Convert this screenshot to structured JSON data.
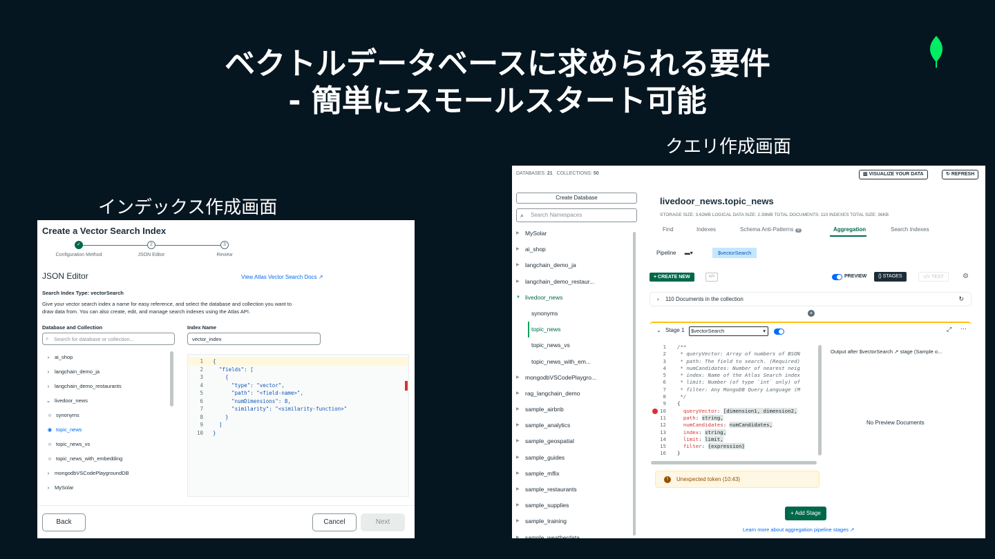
{
  "slide": {
    "title_line1": "ベクトルデータベースに求められる要件",
    "title_line2": "- 簡単にスモールスタート可能",
    "caption_left": "インデックス作成画面",
    "caption_right": "クエリ作成画面"
  },
  "index_panel": {
    "title": "Create a Vector Search Index",
    "steps": [
      "Configuration Method",
      "JSON Editor",
      "Review"
    ],
    "editor_heading": "JSON Editor",
    "docs_link": "View Atlas Vector Search Docs ↗",
    "index_type_label": "Search Index Type: vectorSearch",
    "description_line1": "Give your vector search index a name for easy reference, and select the database and collection you want to",
    "description_line2": "draw data from. You can also create, edit, and manage search indexes using the Atlas API.",
    "db_collection_label": "Database and Collection",
    "db_search_placeholder": "Search for database or collection...",
    "index_name_label": "Index Name",
    "index_name_value": "vector_index",
    "tree": [
      {
        "label": "ai_shop",
        "type": "db"
      },
      {
        "label": "langchain_demo_ja",
        "type": "db"
      },
      {
        "label": "langchain_demo_restaurants",
        "type": "db"
      },
      {
        "label": "livedoor_news",
        "type": "db-open"
      },
      {
        "label": "synonyms",
        "type": "radio"
      },
      {
        "label": "topic_news",
        "type": "radio-selected"
      },
      {
        "label": "topic_news_vs",
        "type": "radio"
      },
      {
        "label": "topic_news_with_embedding",
        "type": "radio"
      },
      {
        "label": "mongodbVSCodePlaygroundDB",
        "type": "db"
      },
      {
        "label": "MySolar",
        "type": "db"
      }
    ],
    "code": [
      "{",
      "  \"fields\": [",
      "    {",
      "      \"type\": \"vector\",",
      "      \"path\": \"<field-name>\",",
      "      \"numDimensions\": 8,",
      "      \"similarity\": \"<similarity-function>\"",
      "    }",
      "  ]",
      "}"
    ],
    "back_label": "Back",
    "cancel_label": "Cancel",
    "next_label": "Next"
  },
  "query_panel": {
    "top_info_db_label": "DATABASES:",
    "top_info_db_count": "21",
    "top_info_coll_label": "COLLECTIONS:",
    "top_info_coll_count": "50",
    "visualize_label": "VISUALIZE YOUR DATA",
    "refresh_label": "REFRESH",
    "create_db_label": "Create Database",
    "ns_search_placeholder": "Search Namespaces",
    "namespaces": [
      {
        "label": "MySolar",
        "type": "db"
      },
      {
        "label": "ai_shop",
        "type": "db"
      },
      {
        "label": "langchain_demo_ja",
        "type": "db"
      },
      {
        "label": "langchain_demo_restaur...",
        "type": "db"
      },
      {
        "label": "livedoor_news",
        "type": "db-open"
      },
      {
        "label": "synonyms",
        "type": "coll"
      },
      {
        "label": "topic_news",
        "type": "coll-active"
      },
      {
        "label": "topic_news_vs",
        "type": "coll"
      },
      {
        "label": "topic_news_with_em...",
        "type": "coll"
      },
      {
        "label": "mongodbVSCodePlaygro...",
        "type": "db"
      },
      {
        "label": "rag_langchain_demo",
        "type": "db"
      },
      {
        "label": "sample_airbnb",
        "type": "db"
      },
      {
        "label": "sample_analytics",
        "type": "db"
      },
      {
        "label": "sample_geospatial",
        "type": "db"
      },
      {
        "label": "sample_guides",
        "type": "db"
      },
      {
        "label": "sample_mflix",
        "type": "db"
      },
      {
        "label": "sample_restaurants",
        "type": "db"
      },
      {
        "label": "sample_supplies",
        "type": "db"
      },
      {
        "label": "sample_training",
        "type": "db"
      },
      {
        "label": "sample_weatherdata",
        "type": "db"
      }
    ],
    "namespace_title": "livedoor_news.topic_news",
    "stats": "STORAGE SIZE: 3.62MB     LOGICAL DATA SIZE: 2.39MB     TOTAL DOCUMENTS: 110     INDEXES TOTAL SIZE: 36KB",
    "tabs": [
      "Find",
      "Indexes",
      "Schema Anti-Patterns",
      "Aggregation",
      "Search Indexes"
    ],
    "schema_badge": "0",
    "active_tab": "Aggregation",
    "pipeline_label": "Pipeline",
    "stage_chip": "$vectorSearch",
    "create_new_label": "CREATE NEW",
    "preview_label": "PREVIEW",
    "stages_label": "{} STAGES",
    "text_label": "</> TEXT",
    "docs_in_collection": "110 Documents in the collection",
    "stage_label": "Stage 1",
    "stage_operator": "$vectorSearch",
    "code": [
      {
        "n": "1",
        "t": "/**",
        "c": "cm"
      },
      {
        "n": "2",
        "t": " * queryVector: Array of numbers of BSON",
        "c": "cm"
      },
      {
        "n": "3",
        "t": " * path: The field to search. (Required)",
        "c": "cm"
      },
      {
        "n": "4",
        "t": " * numCandidates: Number of nearest neig",
        "c": "cm"
      },
      {
        "n": "5",
        "t": " * index: Name of the Atlas Search index",
        "c": "cm"
      },
      {
        "n": "6",
        "t": " * limit: Number (of type `int` only) of",
        "c": "cm"
      },
      {
        "n": "7",
        "t": " * filter: Any MongoDB Query Language (M",
        "c": "cm"
      },
      {
        "n": "8",
        "t": " */",
        "c": "cm"
      },
      {
        "n": "9",
        "t": "{",
        "c": ""
      },
      {
        "n": "10",
        "k": "queryVector",
        "v": "[dimension1, dimension2,",
        "c": "err"
      },
      {
        "n": "11",
        "k": "path",
        "v": "string,",
        "c": ""
      },
      {
        "n": "12",
        "k": "numCandidates",
        "v": "numCandidates,",
        "c": ""
      },
      {
        "n": "13",
        "k": "index",
        "v": "string,",
        "c": ""
      },
      {
        "n": "14",
        "k": "limit",
        "v": "limit,",
        "c": ""
      },
      {
        "n": "15",
        "k": "filter",
        "v": "{expression}",
        "c": ""
      },
      {
        "n": "16",
        "t": "}",
        "c": ""
      }
    ],
    "output_label": "Output after $vectorSearch ↗ stage (Sample o...",
    "no_preview": "No Preview Documents",
    "error_text": "Unexpected token (10:43)",
    "add_stage_label": "+ Add Stage",
    "learn_link": "Learn more about aggregation pipeline stages ↗",
    "colors": {
      "brand_green": "#00684a",
      "link_blue": "#016bf8",
      "warning": "#ffc010"
    }
  }
}
